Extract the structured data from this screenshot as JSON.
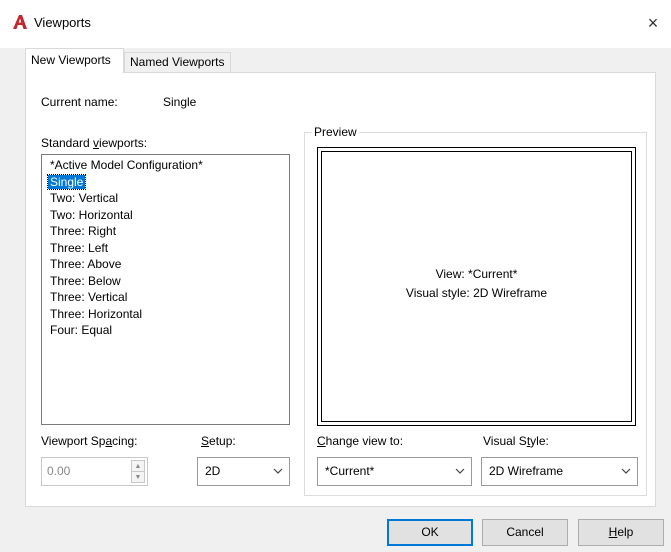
{
  "window": {
    "title": "Viewports",
    "close_glyph": "×",
    "logo_icon": "autocad-logo-icon",
    "accent_color": "#c1272d"
  },
  "tabs": [
    {
      "label": "New Viewports",
      "active": true
    },
    {
      "label": "Named Viewports",
      "active": false
    }
  ],
  "current_name": {
    "label": "Current name:",
    "value": "Single"
  },
  "standard_viewports": {
    "label_pre": "Standard ",
    "label_u": "v",
    "label_post": "iewports:",
    "items": [
      "*Active Model Configuration*",
      "Single",
      "Two:  Vertical",
      "Two:  Horizontal",
      "Three: Right",
      "Three: Left",
      "Three: Above",
      "Three: Below",
      "Three: Vertical",
      "Three: Horizontal",
      "Four:  Equal"
    ],
    "selected_index": 1
  },
  "preview": {
    "label": "Preview",
    "view_text": "View: *Current*",
    "style_text": "Visual style: 2D Wireframe"
  },
  "viewport_spacing": {
    "label_pre": "Viewport Sp",
    "label_u": "a",
    "label_post": "cing:",
    "value": "0.00",
    "spin_up": "▲",
    "spin_down": "▼"
  },
  "setup": {
    "label_pre": "",
    "label_u": "S",
    "label_post": "etup:",
    "value": "2D"
  },
  "change_view": {
    "label_pre": "",
    "label_u": "C",
    "label_post": "hange view to:",
    "value": "*Current*"
  },
  "visual_style": {
    "label_pre": "Visual S",
    "label_u": "t",
    "label_post": "yle:",
    "value": "2D Wireframe"
  },
  "buttons": {
    "ok": "OK",
    "cancel": "Cancel",
    "help_u": "H",
    "help_post": "elp"
  }
}
